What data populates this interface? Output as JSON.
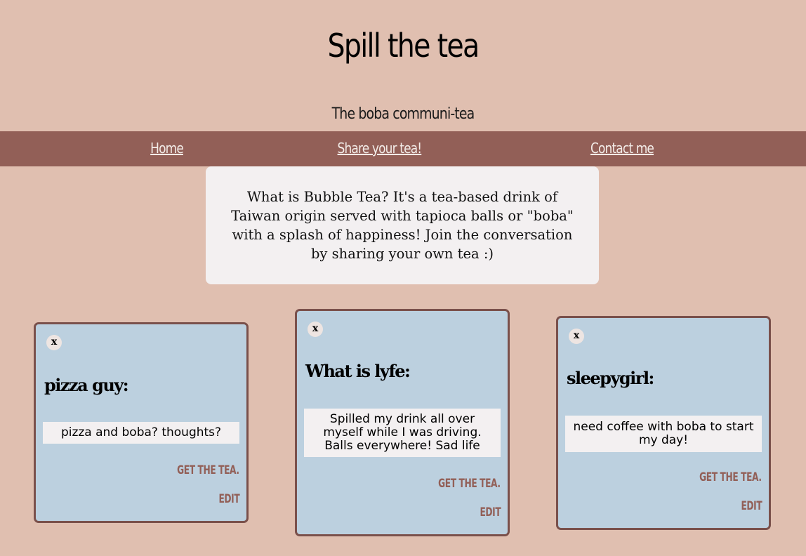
{
  "header": {
    "title": "Spill the tea",
    "tagline": "The boba communi-tea"
  },
  "nav": {
    "home": "Home",
    "share": "Share your tea!",
    "contact": "Contact me"
  },
  "intro": {
    "text": "What is Bubble Tea? It's a tea-based drink of Taiwan origin served with tapioca balls or \"boba\" with a splash of happiness! Join the conversation by sharing your own tea :)"
  },
  "posts": [
    {
      "close_label": "x",
      "user": "pizza guy:",
      "message": "pizza and boba? thoughts?",
      "get_label": "GET THE TEA.",
      "edit_label": "EDIT"
    },
    {
      "close_label": "x",
      "user": "What is lyfe:",
      "message": "Spilled my drink all over myself while I was driving. Balls everywhere! Sad life",
      "get_label": "GET THE TEA.",
      "edit_label": "EDIT"
    },
    {
      "close_label": "x",
      "user": "sleepygirl:",
      "message": "need coffee with boba to start my day!",
      "get_label": "GET THE TEA.",
      "edit_label": "EDIT"
    }
  ],
  "colors": {
    "background": "#e0bfb0",
    "nav": "#925f57",
    "card": "#bcd0df",
    "card_border": "#7a504b",
    "box": "#f3f0f1"
  }
}
